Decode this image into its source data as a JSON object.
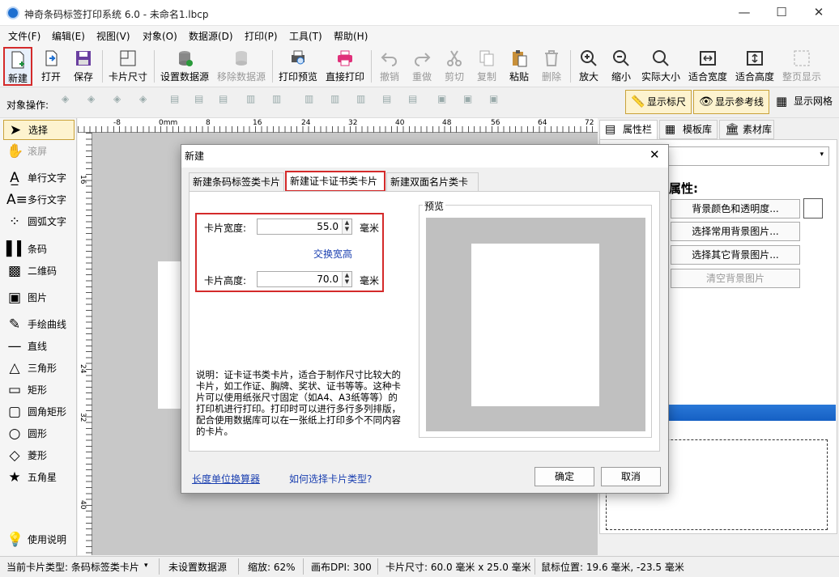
{
  "window": {
    "title": "神奇条码标签打印系统 6.0 - 未命名1.lbcp"
  },
  "menu": [
    "文件(F)",
    "编辑(E)",
    "视图(V)",
    "对象(O)",
    "数据源(D)",
    "打印(P)",
    "工具(T)",
    "帮助(H)"
  ],
  "toolbar": {
    "new": "新建",
    "open": "打开",
    "save": "保存",
    "card_size": "卡片尺寸",
    "set_ds": "设置数据源",
    "remove_ds": "移除数据源",
    "preview": "打印预览",
    "print": "直接打印",
    "undo": "撤销",
    "redo": "重做",
    "cut": "剪切",
    "copy": "复制",
    "paste": "粘贴",
    "delete": "删除",
    "zoom_in": "放大",
    "zoom_out": "缩小",
    "actual": "实际大小",
    "fit_w": "适合宽度",
    "fit_h": "适合高度",
    "full": "整页显示"
  },
  "objbar": {
    "label": "对象操作:",
    "show_ruler": "显示标尺",
    "show_guides": "显示参考线",
    "show_grid": "显示网格"
  },
  "tools": [
    "选择",
    "滚屏",
    "单行文字",
    "多行文字",
    "圆弧文字",
    "条码",
    "二维码",
    "图片",
    "手绘曲线",
    "直线",
    "三角形",
    "矩形",
    "圆角矩形",
    "圆形",
    "菱形",
    "五角星",
    "使用说明"
  ],
  "ruler": {
    "top": [
      "-8",
      "0mm",
      "8",
      "16",
      "24",
      "32",
      "40",
      "48",
      "56",
      "64",
      "72"
    ],
    "left": [
      "16",
      "24",
      "32",
      "40"
    ]
  },
  "right": {
    "tabs": [
      "属性栏",
      "模板库",
      "素材库"
    ],
    "prop_title": "属性:",
    "buttons": [
      "背景颜色和透明度...",
      "选择常用背景图片...",
      "选择其它背景图片...",
      "清空背景图片"
    ]
  },
  "dialog": {
    "title": "新建",
    "tabs": [
      "新建条码标签类卡片",
      "新建证卡证书类卡片",
      "新建双面名片类卡片"
    ],
    "width_label": "卡片宽度:",
    "width_value": "55.0",
    "unit": "毫米",
    "swap": "交换宽高",
    "height_label": "卡片高度:",
    "height_value": "70.0",
    "preview_label": "预览",
    "desc": "说明：证卡证书类卡片，适合于制作尺寸比较大的卡片，如工作证、胸牌、奖状、证书等等。这种卡片可以使用纸张尺寸固定（如A4、A3纸等等）的打印机进行打印。打印时可以进行多行多列排版，配合使用数据库可以在一张纸上打印多个不同内容的卡片。",
    "link1": "长度单位换算器",
    "link2": "如何选择卡片类型?",
    "ok": "确定",
    "cancel": "取消"
  },
  "status": {
    "card_type": "当前卡片类型: 条码标签类卡片",
    "ds": "未设置数据源",
    "zoom": "缩放: 62%",
    "dpi": "画布DPI: 300",
    "card_size": "卡片尺寸: 60.0 毫米 x 25.0 毫米",
    "mouse": "鼠标位置: 19.6 毫米, -23.5 毫米"
  },
  "colors": {
    "accent": "#1e6fd0",
    "highlight": "#d42a2a",
    "link": "#1a3fb0",
    "bar": "#1560c4"
  }
}
